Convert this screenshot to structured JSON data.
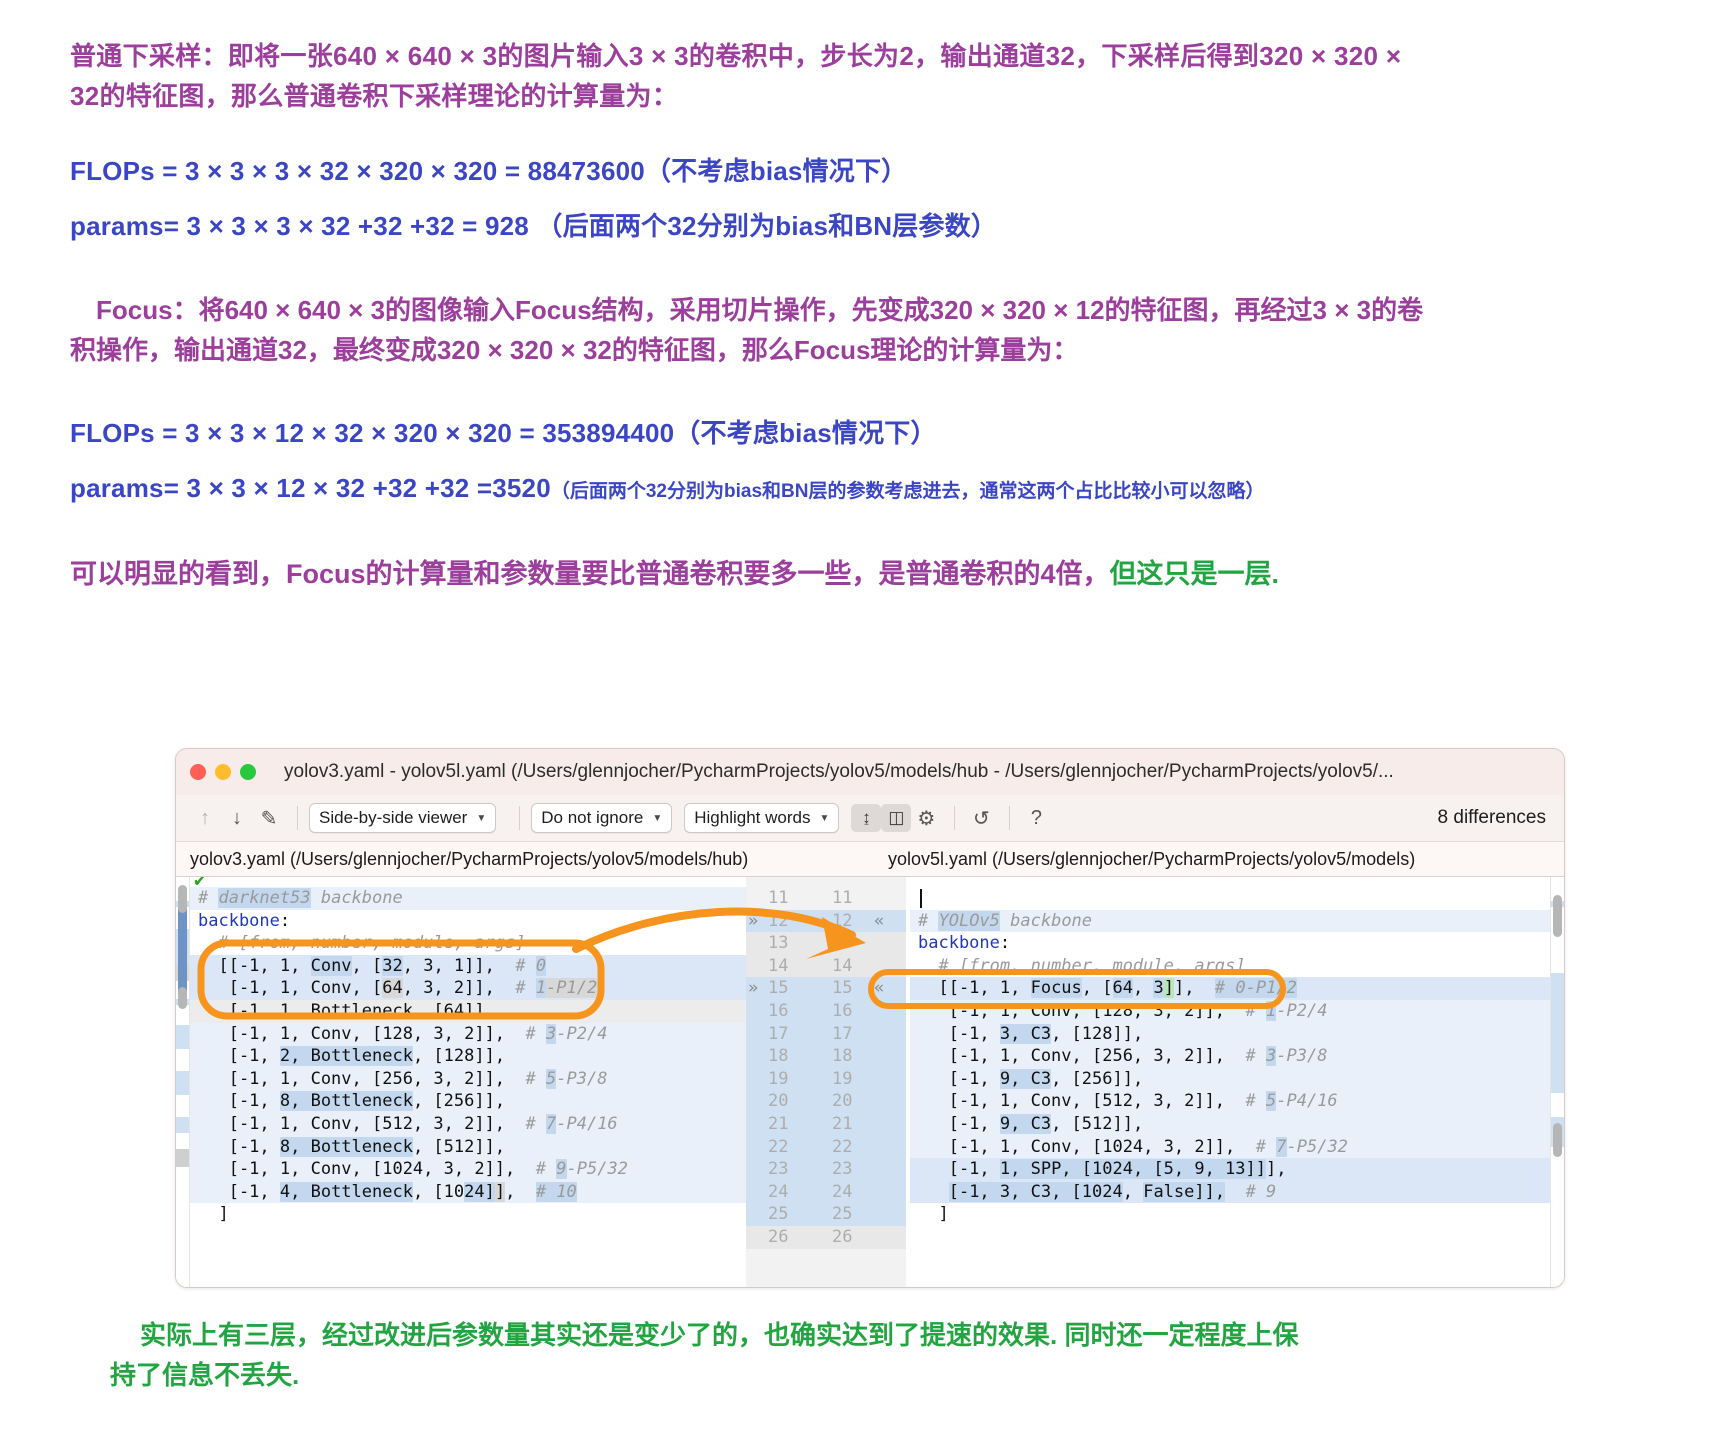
{
  "article": {
    "intro": {
      "color": "#9c3f9c",
      "line1": "普通下采样：即将一张640 × 640 × 3的图片输入3 × 3的卷积中，步长为2，输出通道32，下采样后得到320 × 320 ×",
      "line2": "32的特征图，那么普通卷积下采样理论的计算量为："
    },
    "formula1": {
      "color": "#3b46c4",
      "flops": "FLOPs = 3 × 3 × 3 × 32 × 320 × 320 = 88473600（不考虑bias情况下）",
      "params": "params= 3 × 3 × 3 × 32 +32 +32 = 928   （后面两个32分别为bias和BN层参数）"
    },
    "focus": {
      "color": "#9c3f9c",
      "line1": "Focus：将640 × 640 × 3的图像输入Focus结构，采用切片操作，先变成320 × 320 × 12的特征图，再经过3 × 3的卷",
      "line2": "积操作，输出通道32，最终变成320 × 320 × 32的特征图，那么Focus理论的计算量为："
    },
    "formula2": {
      "color": "#3b46c4",
      "flops": "FLOPs = 3 × 3 × 12 × 32 × 320 × 320 = 353894400（不考虑bias情况下）",
      "params_main": "params= 3 × 3 × 12 × 32 +32 +32 =3520",
      "params_note": "（后面两个32分别为bias和BN层的参数考虑进去，通常这两个占比比较小可以忽略）"
    },
    "conclusion": {
      "purple_color": "#9c3f9c",
      "green_color": "#22a541",
      "purple_part": "可以明显的看到，Focus的计算量和参数量要比普通卷积要多一些，是普通卷积的4倍，",
      "green_part": "但这只是一层."
    },
    "bottom": {
      "color": "#22a541",
      "line1": "实际上有三层，经过改进后参数量其实还是变少了的，也确实达到了提速的效果. 同时还一定程度上保",
      "line2": "持了信息不丢失."
    }
  },
  "screenshot": {
    "window": {
      "title": "yolov3.yaml - yolov5l.yaml (/Users/glennjocher/PycharmProjects/yolov5/models/hub - /Users/glennjocher/PycharmProjects/yolov5/...",
      "traffic_lights": [
        "close-red",
        "minimize-amber",
        "zoom-green"
      ]
    },
    "toolbar": {
      "prev_icon": "arrow-up-icon",
      "next_icon": "arrow-down-icon",
      "edit_icon": "pencil-icon",
      "viewer_mode": "Side-by-side viewer",
      "ignore_mode": "Do not ignore",
      "highlight_mode": "Highlight words",
      "collapse_icon": "collapse-unchanged-icon",
      "whitespace_icon": "show-whitespace-icon",
      "settings_icon": "gear-icon",
      "sync_icon": "sync-scroll-icon",
      "help_icon": "help-icon",
      "differences": "8 differences"
    },
    "paths": {
      "left": "yolov3.yaml (/Users/glennjocher/PycharmProjects/yolov5/models/hub)",
      "right": "yolov5l.yaml (/Users/glennjocher/PycharmProjects/yolov5/models)"
    },
    "left_code": [
      "# darknet53 backbone",
      "backbone:",
      "  # [from, number, module, args]",
      "  [[-1, 1, Conv, [32, 3, 1]],   # 0",
      "   [-1, 1, Conv, [64, 3, 2]],   # 1-P1/2",
      "   [-1, 1, Bottleneck, [64]],",
      "   [-1, 1, Conv, [128, 3, 2]],   # 3-P2/4",
      "   [-1, 2, Bottleneck, [128]],",
      "   [-1, 1, Conv, [256, 3, 2]],   # 5-P3/8",
      "   [-1, 8, Bottleneck, [256]],",
      "   [-1, 1, Conv, [512, 3, 2]],   # 7-P4/16",
      "   [-1, 8, Bottleneck, [512]],",
      "   [-1, 1, Conv, [1024, 3, 2]],   # 9-P5/32",
      "   [-1, 4, Bottleneck, [1024]],   # 10",
      "  ]"
    ],
    "right_code": [
      "# YOLOv5 backbone",
      "backbone:",
      "  # [from, number, module, args]",
      "  [[-1, 1, Focus, [64, 3]],   # 0-P1/2",
      "   [-1, 1, Conv, [128, 3, 2]],   # 1-P2/4",
      "   [-1, 3, C3, [128]],",
      "   [-1, 1, Conv, [256, 3, 2]],   # 3-P3/8",
      "   [-1, 9, C3, [256]],",
      "   [-1, 1, Conv, [512, 3, 2]],   # 5-P4/16",
      "   [-1, 9, C3, [512]],",
      "   [-1, 1, Conv, [1024, 3, 2]],   # 7-P5/32",
      "   [-1, 1, SPP, [1024, [5, 9, 13]]],",
      "   [-1, 3, C3, [1024, False]],   # 9",
      "  ]"
    ],
    "gutter_rows": [
      {
        "left": "11",
        "right": "11",
        "marker_left": "",
        "marker_right": "",
        "state": "plain"
      },
      {
        "left": "12",
        "right": "12",
        "marker_left": "»",
        "marker_right": "«",
        "state": "changed"
      },
      {
        "left": "13",
        "right": "13",
        "marker_left": "",
        "marker_right": "",
        "state": "plain"
      },
      {
        "left": "14",
        "right": "14",
        "marker_left": "",
        "marker_right": "",
        "state": "plain"
      },
      {
        "left": "15",
        "right": "15",
        "marker_left": "»",
        "marker_right": "«",
        "state": "changed"
      },
      {
        "left": "16",
        "right": "16",
        "marker_left": "",
        "marker_right": "",
        "state": "plain"
      },
      {
        "left": "17",
        "right": "17",
        "marker_left": "",
        "marker_right": "",
        "state": "plain"
      },
      {
        "left": "18",
        "right": "18",
        "marker_left": "",
        "marker_right": "",
        "state": "plain"
      },
      {
        "left": "19",
        "right": "19",
        "marker_left": "",
        "marker_right": "",
        "state": "plain"
      },
      {
        "left": "20",
        "right": "20",
        "marker_left": "",
        "marker_right": "",
        "state": "plain"
      },
      {
        "left": "21",
        "right": "21",
        "marker_left": "",
        "marker_right": "",
        "state": "plain"
      },
      {
        "left": "22",
        "right": "22",
        "marker_left": "",
        "marker_right": "",
        "state": "plain"
      },
      {
        "left": "23",
        "right": "23",
        "marker_left": "",
        "marker_right": "",
        "state": "plain"
      },
      {
        "left": "24",
        "right": "24",
        "marker_left": "",
        "marker_right": "",
        "state": "plain"
      },
      {
        "left": "25",
        "right": "25",
        "marker_left": "",
        "marker_right": "",
        "state": "plain"
      },
      {
        "left": "26",
        "right": "26",
        "marker_left": "",
        "marker_right": "",
        "state": "plain"
      }
    ],
    "annotations": {
      "color": "#f7941d",
      "left_box_label": "highlight-ellipse-left",
      "right_box_label": "highlight-ellipse-right",
      "arrow_label": "orange-arrow"
    }
  }
}
